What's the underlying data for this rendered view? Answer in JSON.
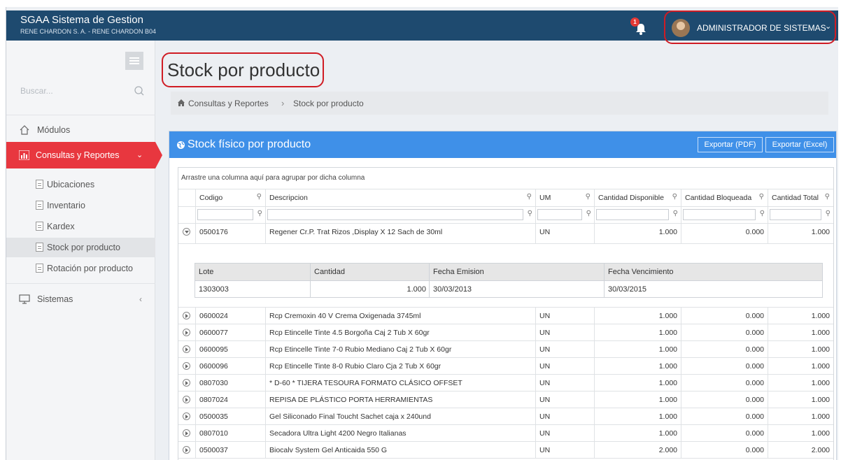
{
  "topbar": {
    "app_title": "SGAA Sistema de Gestion",
    "company": "RENE CHARDON S. A. - RENE CHARDON B04",
    "notifications_count": "1",
    "user_name": "ADMINISTRADOR DE SISTEMAS"
  },
  "sidebar": {
    "search_placeholder": "Buscar...",
    "items": [
      {
        "label": "Módulos",
        "icon": "home-icon"
      },
      {
        "label": "Consultas y Reportes",
        "icon": "bar-chart-icon",
        "active": true
      },
      {
        "label": "Sistemas",
        "icon": "monitor-icon"
      }
    ],
    "subitems": [
      {
        "label": "Ubicaciones"
      },
      {
        "label": "Inventario"
      },
      {
        "label": "Kardex"
      },
      {
        "label": "Stock por producto",
        "selected": true
      },
      {
        "label": "Rotación por producto"
      }
    ]
  },
  "page": {
    "title": "Stock por producto",
    "breadcrumb": [
      "Consultas y Reportes",
      "Stock por producto"
    ]
  },
  "panel": {
    "title": "Stock físico por producto",
    "export_pdf": "Exportar (PDF)",
    "export_excel": "Exportar (Excel)"
  },
  "grid": {
    "group_hint": "Arrastre una columna aquí para agrupar por dicha columna",
    "columns": [
      "Codigo",
      "Descripcion",
      "UM",
      "Cantidad Disponible",
      "Cantidad Bloqueada",
      "Cantidad Total"
    ],
    "rows": [
      {
        "codigo": "0500176",
        "descripcion": "Regener Cr.P. Trat Rizos ,Display X 12 Sach de 30ml",
        "um": "UN",
        "disponible": "1.000",
        "bloqueada": "0.000",
        "total": "1.000"
      },
      {
        "codigo": "0600024",
        "descripcion": "Rcp Cremoxin 40 V Crema Oxigenada 3745ml",
        "um": "UN",
        "disponible": "1.000",
        "bloqueada": "0.000",
        "total": "1.000"
      },
      {
        "codigo": "0600077",
        "descripcion": "Rcp Etincelle Tinte 4.5 Borgoña Caj 2 Tub X 60gr",
        "um": "UN",
        "disponible": "1.000",
        "bloqueada": "0.000",
        "total": "1.000"
      },
      {
        "codigo": "0600095",
        "descripcion": "Rcp Etincelle Tinte 7-0 Rubio Mediano Caj 2 Tub X 60gr",
        "um": "UN",
        "disponible": "1.000",
        "bloqueada": "0.000",
        "total": "1.000"
      },
      {
        "codigo": "0600096",
        "descripcion": "Rcp Etincelle Tinte 8-0 Rubio Claro Cja 2 Tub X 60gr",
        "um": "UN",
        "disponible": "1.000",
        "bloqueada": "0.000",
        "total": "1.000"
      },
      {
        "codigo": "0807030",
        "descripcion": "* D-60 * TIJERA TESOURA FORMATO CLÁSICO OFFSET",
        "um": "UN",
        "disponible": "1.000",
        "bloqueada": "0.000",
        "total": "1.000"
      },
      {
        "codigo": "0807024",
        "descripcion": "REPISA DE PLÁSTICO PORTA HERRAMIENTAS",
        "um": "UN",
        "disponible": "1.000",
        "bloqueada": "0.000",
        "total": "1.000"
      },
      {
        "codigo": "0500035",
        "descripcion": "Gel Siliconado Final Toucht Sachet caja x 240und",
        "um": "UN",
        "disponible": "1.000",
        "bloqueada": "0.000",
        "total": "1.000"
      },
      {
        "codigo": "0807010",
        "descripcion": "Secadora Ultra Light 4200 Negro Italianas",
        "um": "UN",
        "disponible": "1.000",
        "bloqueada": "0.000",
        "total": "1.000"
      },
      {
        "codigo": "0500037",
        "descripcion": "Biocalv System Gel Anticaida 550 G",
        "um": "UN",
        "disponible": "2.000",
        "bloqueada": "0.000",
        "total": "2.000"
      }
    ],
    "detail": {
      "columns": [
        "Lote",
        "Cantidad",
        "Fecha Emision",
        "Fecha Vencimiento"
      ],
      "row": {
        "lote": "1303003",
        "cantidad": "1.000",
        "emision": "30/03/2013",
        "vencimiento": "30/03/2015"
      }
    }
  },
  "colors": {
    "topbar": "#1e4a6f",
    "active_menu": "#e8373f",
    "panel_header": "#3f90e8",
    "highlight": "#d01c24"
  }
}
